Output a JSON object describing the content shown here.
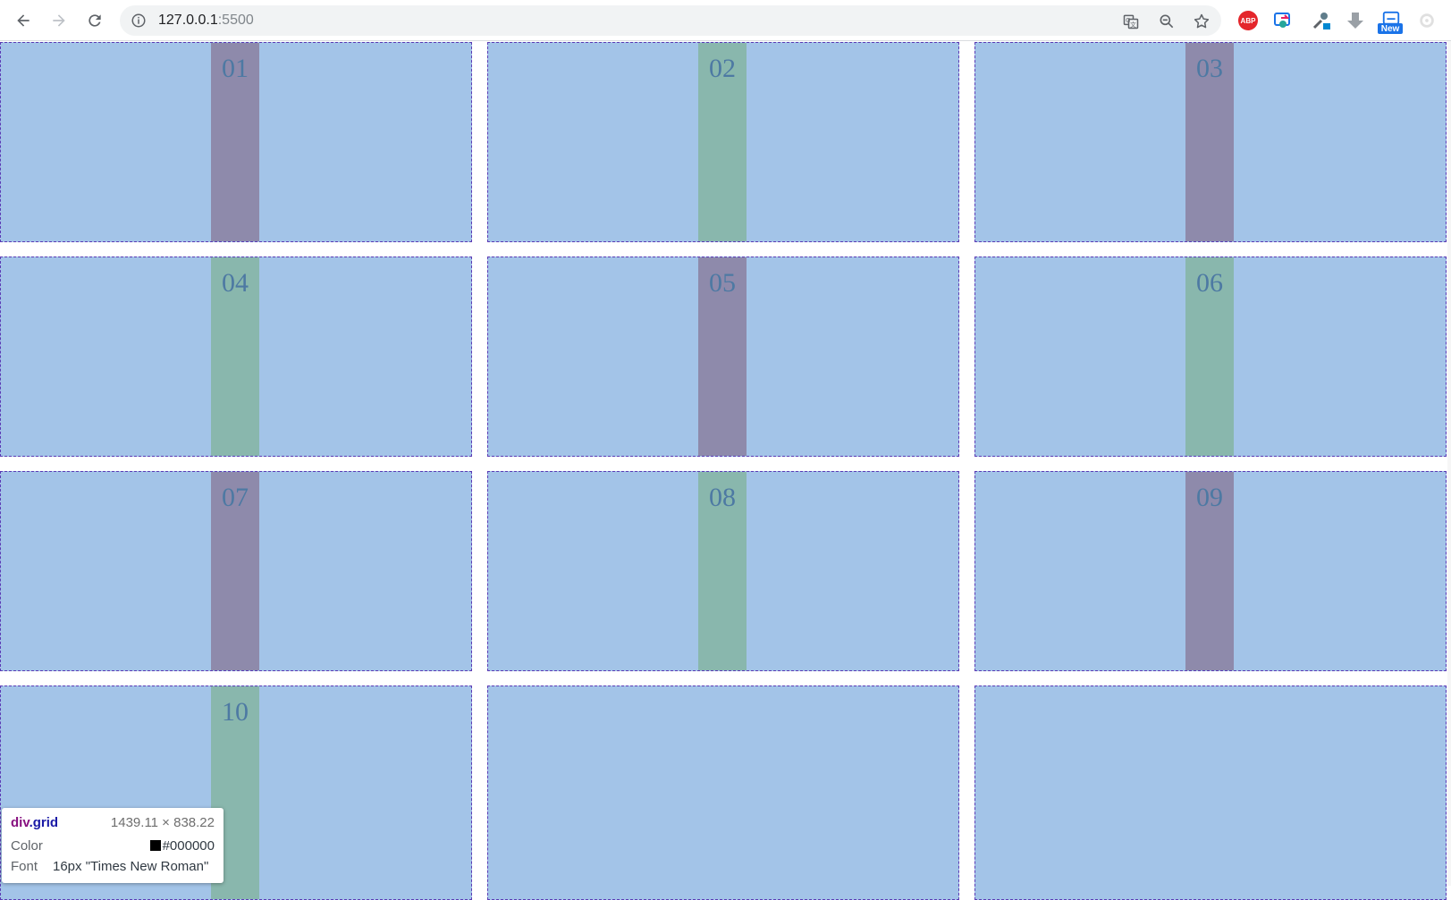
{
  "browser": {
    "url_host": "127.0.0.1",
    "url_port": ":5500",
    "abp_label": "ABP",
    "new_badge": "New"
  },
  "grid": {
    "items": [
      {
        "label": "01",
        "stripe": "purple"
      },
      {
        "label": "02",
        "stripe": "green"
      },
      {
        "label": "03",
        "stripe": "purple"
      },
      {
        "label": "04",
        "stripe": "green"
      },
      {
        "label": "05",
        "stripe": "purple"
      },
      {
        "label": "06",
        "stripe": "green"
      },
      {
        "label": "07",
        "stripe": "purple"
      },
      {
        "label": "08",
        "stripe": "green"
      },
      {
        "label": "09",
        "stripe": "purple"
      },
      {
        "label": "10",
        "stripe": "green"
      },
      {
        "label": "",
        "stripe": "none"
      },
      {
        "label": "",
        "stripe": "none"
      }
    ],
    "colors": {
      "cell": "#a3c4e8",
      "purple_stripe": "#8e8aab",
      "green_stripe": "#89b7ad",
      "border": "#5b3bb5",
      "label": "#4d79a3"
    }
  },
  "tooltip": {
    "tag": "div",
    "class_name": ".grid",
    "dimensions": "1439.11 × 838.22",
    "color_key": "Color",
    "color_value": "#000000",
    "font_key": "Font",
    "font_value": "16px \"Times New Roman\""
  }
}
